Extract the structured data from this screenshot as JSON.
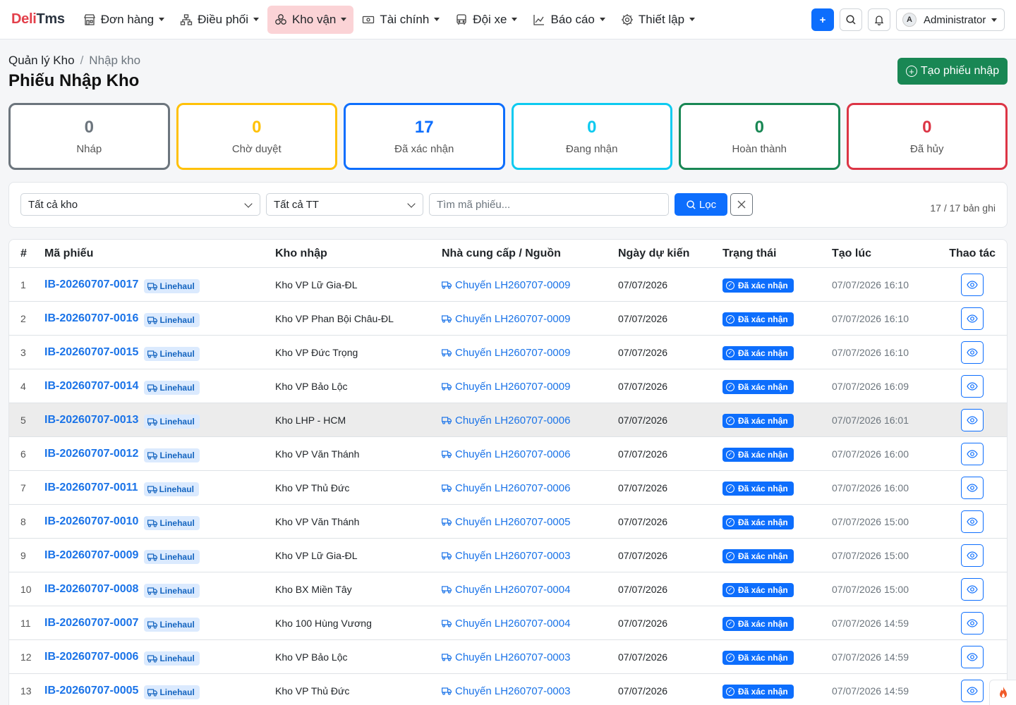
{
  "brand": {
    "part1": "Deli",
    "part2": "Tms"
  },
  "nav": {
    "items": [
      {
        "label": "Đơn hàng",
        "icon": "shop-icon"
      },
      {
        "label": "Điều phối",
        "icon": "diagram-icon"
      },
      {
        "label": "Kho vận",
        "icon": "boxes-icon",
        "active": true
      },
      {
        "label": "Tài chính",
        "icon": "cash-icon"
      },
      {
        "label": "Đội xe",
        "icon": "bus-icon"
      },
      {
        "label": "Báo cáo",
        "icon": "chart-icon"
      },
      {
        "label": "Thiết lập",
        "icon": "gear-icon"
      }
    ],
    "add_label": "+",
    "user": {
      "initial": "A",
      "name": "Administrator"
    }
  },
  "breadcrumb": {
    "parent": "Quản lý Kho",
    "separator": "/",
    "current": "Nhập kho"
  },
  "page_title": "Phiếu Nhập Kho",
  "create_button": "Tạo phiếu nhập",
  "stats": [
    {
      "value": "0",
      "label": "Nháp",
      "color": "#6c757d"
    },
    {
      "value": "0",
      "label": "Chờ duyệt",
      "color": "#ffc107"
    },
    {
      "value": "17",
      "label": "Đã xác nhận",
      "color": "#0d6efd"
    },
    {
      "value": "0",
      "label": "Đang nhận",
      "color": "#0dcaf0"
    },
    {
      "value": "0",
      "label": "Hoàn thành",
      "color": "#198754"
    },
    {
      "value": "0",
      "label": "Đã hủy",
      "color": "#dc3545"
    }
  ],
  "filters": {
    "warehouse_select": "Tất cả kho",
    "status_select": "Tất cả TT",
    "search_placeholder": "Tìm mã phiếu...",
    "filter_button": "Lọc",
    "record_count": "17 / 17 bản ghi"
  },
  "table": {
    "headers": {
      "index": "#",
      "code": "Mã phiếu",
      "warehouse": "Kho nhập",
      "source": "Nhà cung cấp / Nguồn",
      "date": "Ngày dự kiến",
      "status": "Trạng thái",
      "created": "Tạo lúc",
      "actions": "Thao tác"
    },
    "rows": [
      {
        "index": "1",
        "code": "IB-20260707-0017",
        "type": "Linehaul",
        "warehouse": "Kho VP Lữ Gia-ĐL",
        "source": "Chuyến LH260707-0009",
        "date": "07/07/2026",
        "status": "Đã xác nhận",
        "created": "07/07/2026 16:10"
      },
      {
        "index": "2",
        "code": "IB-20260707-0016",
        "type": "Linehaul",
        "warehouse": "Kho VP Phan Bội Châu-ĐL",
        "source": "Chuyến LH260707-0009",
        "date": "07/07/2026",
        "status": "Đã xác nhận",
        "created": "07/07/2026 16:10"
      },
      {
        "index": "3",
        "code": "IB-20260707-0015",
        "type": "Linehaul",
        "warehouse": "Kho VP Đức Trọng",
        "source": "Chuyến LH260707-0009",
        "date": "07/07/2026",
        "status": "Đã xác nhận",
        "created": "07/07/2026 16:10"
      },
      {
        "index": "4",
        "code": "IB-20260707-0014",
        "type": "Linehaul",
        "warehouse": "Kho VP Bảo Lộc",
        "source": "Chuyến LH260707-0009",
        "date": "07/07/2026",
        "status": "Đã xác nhận",
        "created": "07/07/2026 16:09"
      },
      {
        "index": "5",
        "code": "IB-20260707-0013",
        "type": "Linehaul",
        "warehouse": "Kho LHP - HCM",
        "source": "Chuyến LH260707-0006",
        "date": "07/07/2026",
        "status": "Đã xác nhận",
        "created": "07/07/2026 16:01",
        "highlight": true
      },
      {
        "index": "6",
        "code": "IB-20260707-0012",
        "type": "Linehaul",
        "warehouse": "Kho VP Văn Thánh",
        "source": "Chuyến LH260707-0006",
        "date": "07/07/2026",
        "status": "Đã xác nhận",
        "created": "07/07/2026 16:00"
      },
      {
        "index": "7",
        "code": "IB-20260707-0011",
        "type": "Linehaul",
        "warehouse": "Kho VP Thủ Đức",
        "source": "Chuyến LH260707-0006",
        "date": "07/07/2026",
        "status": "Đã xác nhận",
        "created": "07/07/2026 16:00"
      },
      {
        "index": "8",
        "code": "IB-20260707-0010",
        "type": "Linehaul",
        "warehouse": "Kho VP Văn Thánh",
        "source": "Chuyến LH260707-0005",
        "date": "07/07/2026",
        "status": "Đã xác nhận",
        "created": "07/07/2026 15:00"
      },
      {
        "index": "9",
        "code": "IB-20260707-0009",
        "type": "Linehaul",
        "warehouse": "Kho VP Lữ Gia-ĐL",
        "source": "Chuyến LH260707-0003",
        "date": "07/07/2026",
        "status": "Đã xác nhận",
        "created": "07/07/2026 15:00"
      },
      {
        "index": "10",
        "code": "IB-20260707-0008",
        "type": "Linehaul",
        "warehouse": "Kho BX Miền Tây",
        "source": "Chuyến LH260707-0004",
        "date": "07/07/2026",
        "status": "Đã xác nhận",
        "created": "07/07/2026 15:00"
      },
      {
        "index": "11",
        "code": "IB-20260707-0007",
        "type": "Linehaul",
        "warehouse": "Kho 100 Hùng Vương",
        "source": "Chuyến LH260707-0004",
        "date": "07/07/2026",
        "status": "Đã xác nhận",
        "created": "07/07/2026 14:59"
      },
      {
        "index": "12",
        "code": "IB-20260707-0006",
        "type": "Linehaul",
        "warehouse": "Kho VP Bảo Lộc",
        "source": "Chuyến LH260707-0003",
        "date": "07/07/2026",
        "status": "Đã xác nhận",
        "created": "07/07/2026 14:59"
      },
      {
        "index": "13",
        "code": "IB-20260707-0005",
        "type": "Linehaul",
        "warehouse": "Kho VP Thủ Đức",
        "source": "Chuyến LH260707-0003",
        "date": "07/07/2026",
        "status": "Đã xác nhận",
        "created": "07/07/2026 14:59"
      }
    ]
  },
  "colors": {
    "accent": "#0d6efd",
    "brand_red": "#e3404b",
    "success": "#198754",
    "link": "#1a73e8"
  }
}
